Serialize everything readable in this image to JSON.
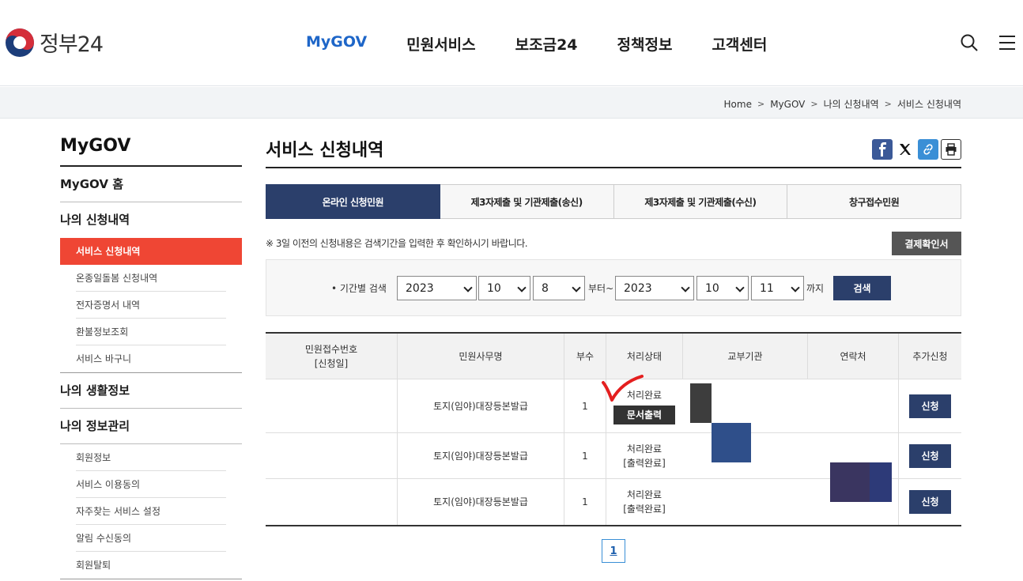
{
  "header": {
    "logo_text": "정부24",
    "nav": [
      "MyGOV",
      "민원서비스",
      "보조금24",
      "정책정보",
      "고객센터"
    ]
  },
  "breadcrumb": [
    "Home",
    "MyGOV",
    "나의 신청내역",
    "서비스 신청내역"
  ],
  "sidebar": {
    "title": "MyGOV",
    "home": "MyGOV 홈",
    "sec1": "나의 신청내역",
    "sec1_items": [
      "서비스 신청내역",
      "온종일돌봄 신청내역",
      "전자증명서 내역",
      "환불정보조회",
      "서비스 바구니"
    ],
    "sec2": "나의 생활정보",
    "sec3": "나의 정보관리",
    "sec3_items": [
      "회원정보",
      "서비스 이용동의",
      "자주찾는 서비스 설정",
      "알림 수신동의",
      "회원탈퇴"
    ]
  },
  "main": {
    "title": "서비스 신청내역",
    "tabs": [
      "온라인 신청민원",
      "제3자제출 및 기관제출(송신)",
      "제3자제출 및 기관제출(수신)",
      "창구접수민원"
    ],
    "notice": "※ 3일 이전의 신청내용은 검색기간을 입력한 후 확인하시기 바랍니다.",
    "payment_button": "결제확인서",
    "search": {
      "label": "• 기간별 검색",
      "from_year": "2023",
      "from_month": "10",
      "from_day": "8",
      "from_word": "부터~",
      "to_year": "2023",
      "to_month": "10",
      "to_day": "11",
      "to_word": "까지",
      "button": "검색"
    },
    "table": {
      "headers": [
        "민원접수번호",
        "[신청일]",
        "민원사무명",
        "부수",
        "처리상태",
        "교부기관",
        "연락처",
        "추가신청"
      ],
      "rows": [
        {
          "name": "토지(임야)대장등본발급",
          "count": "1",
          "status1": "처리완료",
          "status2": "",
          "doc_button": "문서출력",
          "apply": "신청"
        },
        {
          "name": "토지(임야)대장등본발급",
          "count": "1",
          "status1": "처리완료",
          "status2": "[출력완료]",
          "doc_button": "",
          "apply": "신청"
        },
        {
          "name": "토지(임야)대장등본발급",
          "count": "1",
          "status1": "처리완료",
          "status2": "[출력완료]",
          "doc_button": "",
          "apply": "신청"
        }
      ]
    },
    "page": "1"
  },
  "colors": {
    "primary": "#2b3f6b",
    "accent_red": "#ef4634",
    "nav_active": "#1e66c8"
  }
}
